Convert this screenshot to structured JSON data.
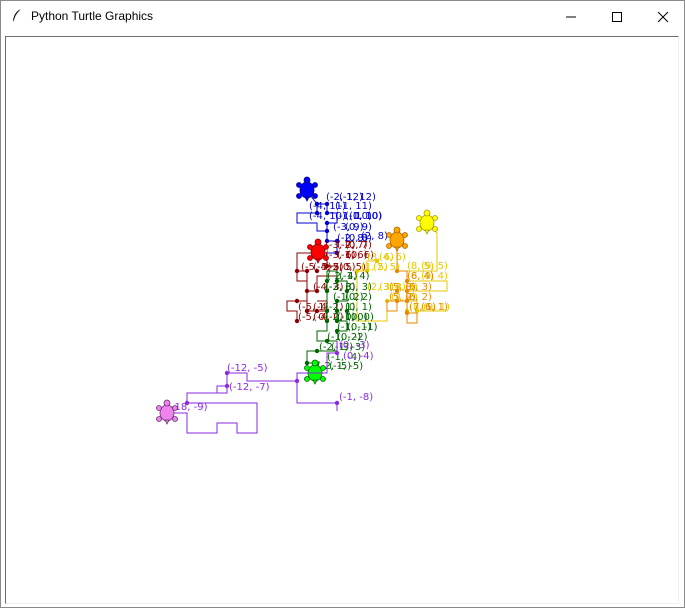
{
  "window": {
    "title": "Python Turtle Graphics",
    "icons": {
      "app": "feather-icon",
      "minimize": "minimize-icon",
      "maximize": "maximize-icon",
      "close": "close-icon"
    }
  },
  "turtles": [
    {
      "id": "blue",
      "color": "#0000cc",
      "fill": "#0000ff",
      "labels": [
        "(-2, 12)",
        "(-1, 12)",
        "(-4, 11)",
        "(-1, 11)",
        "(-4, 10)",
        "(-1, 10)",
        "(-1, 10)",
        "(0, 10)",
        "(-3, 9)",
        "(0, 9)",
        "(-2, 8)",
        "(0, 8)",
        "(2, 8)"
      ]
    },
    {
      "id": "red",
      "color": "#8b0000",
      "fill": "#ff0000",
      "labels": [
        "(-3, 7)",
        "(-2, 7)",
        "(0, 7)",
        "(-3, 6)",
        "(-1, 6)",
        "(0, 6)",
        "(-5, 5)",
        "(-4, 5)",
        "(-2, 5)",
        "(0, 5)",
        "(-4, 3)",
        "(-3, 3)",
        "(-5, 1)",
        "(-4, 1)",
        "(-5, 0)",
        "(-4, 0)"
      ]
    },
    {
      "id": "yellow",
      "color": "#e6c800",
      "fill": "#ffff00",
      "labels": [
        "(3, 6)",
        "(4, 6)",
        "(1, 5)",
        "(2, 5)",
        "(8, 5)",
        "(9, 5)",
        "(8, 4)",
        "(9, 4)",
        "(2, 3)",
        "(3, 3)",
        "(4, 3)",
        "(4, 2)",
        "(8, 1)",
        "(9, 1)"
      ]
    },
    {
      "id": "orange",
      "color": "#e68a00",
      "fill": "#ffa500",
      "labels": [
        "(6, 4)",
        "(5, 3)",
        "(6, 3)",
        "(5, 2)",
        "(6, 2)",
        "(7, 1)",
        "(6, 1)"
      ]
    },
    {
      "id": "green",
      "color": "#006400",
      "fill": "#00ff00",
      "labels": [
        "(-2, 4)",
        "(-1, 4)",
        "(-2, 3)",
        "(0, 3)",
        "(0, 2)",
        "(-1, 2)",
        "(-2, 1)",
        "(0, 1)",
        "(-2, 0)",
        "(-1, 0)",
        "(0, 0)",
        "(-1, -1)",
        "(0, -1)",
        "(-1, -2)",
        "(0, -2)",
        "(-2, -3)",
        "(-1, -3)",
        "(-1, -4)",
        "(-2, -5)",
        "(-1, -5)"
      ]
    },
    {
      "id": "violet",
      "color": "#8a2be2",
      "fill": "#ee82ee",
      "labels": [
        "(0, -3)",
        "(0, -4)",
        "(-12, -5)",
        "(-12, -7)",
        "(-1, -8)",
        "(-18, -9)"
      ]
    }
  ]
}
